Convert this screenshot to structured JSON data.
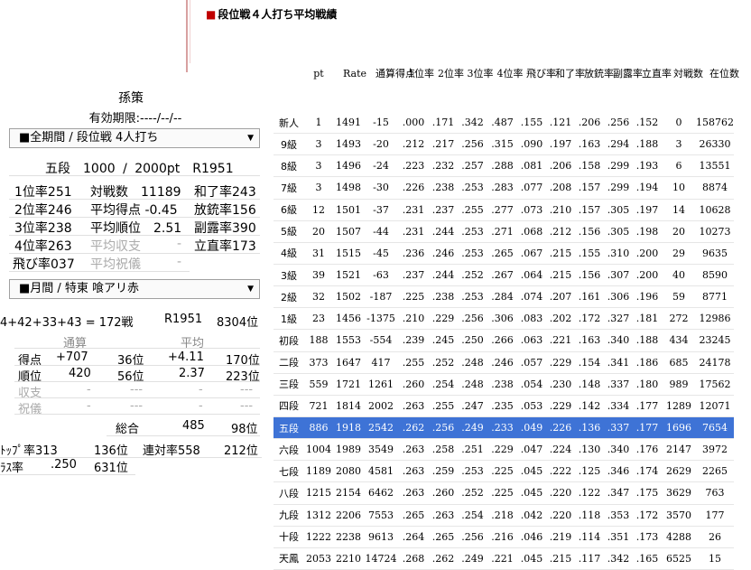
{
  "page_title": "段位戦４人打ち平均戦績",
  "player": {
    "name": "孫策",
    "valid_until": "有効期限:----/--/--"
  },
  "section1": {
    "dropdown": "■全期間 / 段位戦 4人打ち",
    "rank_line": "五段　1000 / 2000pt　R1951",
    "stats": {
      "r1": {
        "a": "1位率251",
        "b": "対戦数　11189",
        "c": "和了率243"
      },
      "r2": {
        "a": "2位率246",
        "b": "平均得点 -0.45",
        "c": "放銃率156"
      },
      "r3": {
        "a": "3位率238",
        "b": "平均順位　2.51",
        "c": "副露率390"
      },
      "r4": {
        "a": "4位率263",
        "b": "平均収支",
        "b2": "-",
        "c": "立直率173"
      },
      "r5": {
        "a": "飛び率037",
        "b": "平均祝儀",
        "b2": "-"
      }
    }
  },
  "section2": {
    "dropdown": "■月間 / 特東 喰アリ赤",
    "line1": {
      "games": "4+42+33+43 = 172戦",
      "rating": "R1951",
      "rank": "8304位"
    },
    "head": {
      "total": "通算",
      "avg": "平均"
    },
    "rows": [
      {
        "label": "得点",
        "v1": "+707",
        "v2": "36位",
        "v3": "+4.11",
        "v4": "170位"
      },
      {
        "label": "順位",
        "v1": "420",
        "v2": "56位",
        "v3": "2.37",
        "v4": "223位"
      },
      {
        "label": "収支",
        "v1": "-",
        "v2": "---",
        "v3": "-",
        "v4": "---"
      },
      {
        "label": "祝儀",
        "v1": "-",
        "v2": "---",
        "v3": "-",
        "v4": "---"
      }
    ],
    "overall": {
      "label": "総合",
      "v1": "485",
      "v2": "98位"
    },
    "top": {
      "a": "ﾄｯﾌﾟ率313",
      "b": "136位",
      "c": "連対率558",
      "d": "212位"
    },
    "las": {
      "a": "ﾗｽ率",
      "b": ".250",
      "c": "631位"
    }
  },
  "table": {
    "headers": [
      "pt",
      "Rate",
      "通算得点",
      "1位率",
      "2位率",
      "3位率",
      "4位率",
      "飛び率",
      "和了率",
      "放銃率",
      "副露率",
      "立直率",
      "対戦数",
      "在位数"
    ],
    "rows": [
      [
        "新人",
        "1",
        "1491",
        "-15",
        ".000",
        ".171",
        ".342",
        ".487",
        ".155",
        ".121",
        ".206",
        ".256",
        ".152",
        "0",
        "158762"
      ],
      [
        "9級",
        "3",
        "1493",
        "-20",
        ".212",
        ".217",
        ".256",
        ".315",
        ".090",
        ".197",
        ".163",
        ".294",
        ".188",
        "3",
        "26330"
      ],
      [
        "8級",
        "3",
        "1496",
        "-24",
        ".223",
        ".232",
        ".257",
        ".288",
        ".081",
        ".206",
        ".158",
        ".299",
        ".193",
        "6",
        "13551"
      ],
      [
        "7級",
        "3",
        "1498",
        "-30",
        ".226",
        ".238",
        ".253",
        ".283",
        ".077",
        ".208",
        ".157",
        ".299",
        ".194",
        "10",
        "8874"
      ],
      [
        "6級",
        "12",
        "1501",
        "-37",
        ".231",
        ".237",
        ".255",
        ".277",
        ".073",
        ".210",
        ".157",
        ".305",
        ".197",
        "14",
        "10628"
      ],
      [
        "5級",
        "20",
        "1507",
        "-44",
        ".231",
        ".244",
        ".253",
        ".271",
        ".068",
        ".212",
        ".156",
        ".305",
        ".198",
        "20",
        "10273"
      ],
      [
        "4級",
        "31",
        "1515",
        "-45",
        ".236",
        ".246",
        ".253",
        ".265",
        ".067",
        ".215",
        ".155",
        ".310",
        ".200",
        "29",
        "9635"
      ],
      [
        "3級",
        "39",
        "1521",
        "-63",
        ".237",
        ".244",
        ".252",
        ".267",
        ".064",
        ".215",
        ".156",
        ".307",
        ".200",
        "40",
        "8590"
      ],
      [
        "2級",
        "32",
        "1502",
        "-187",
        ".225",
        ".238",
        ".253",
        ".284",
        ".074",
        ".207",
        ".161",
        ".306",
        ".196",
        "59",
        "8771"
      ],
      [
        "1級",
        "23",
        "1456",
        "-1375",
        ".210",
        ".229",
        ".256",
        ".306",
        ".083",
        ".202",
        ".172",
        ".327",
        ".181",
        "272",
        "12986"
      ],
      [
        "初段",
        "188",
        "1553",
        "-554",
        ".239",
        ".245",
        ".250",
        ".266",
        ".063",
        ".221",
        ".163",
        ".340",
        ".188",
        "434",
        "23245"
      ],
      [
        "二段",
        "373",
        "1647",
        "417",
        ".255",
        ".252",
        ".248",
        ".246",
        ".057",
        ".229",
        ".154",
        ".341",
        ".186",
        "685",
        "24178"
      ],
      [
        "三段",
        "559",
        "1721",
        "1261",
        ".260",
        ".254",
        ".248",
        ".238",
        ".054",
        ".230",
        ".148",
        ".337",
        ".180",
        "989",
        "17562"
      ],
      [
        "四段",
        "721",
        "1814",
        "2002",
        ".263",
        ".255",
        ".247",
        ".235",
        ".053",
        ".229",
        ".142",
        ".334",
        ".177",
        "1289",
        "12071"
      ],
      [
        "五段",
        "886",
        "1918",
        "2542",
        ".262",
        ".256",
        ".249",
        ".233",
        ".049",
        ".226",
        ".136",
        ".337",
        ".177",
        "1696",
        "7654"
      ],
      [
        "六段",
        "1004",
        "1989",
        "3549",
        ".263",
        ".258",
        ".251",
        ".229",
        ".047",
        ".224",
        ".130",
        ".340",
        ".176",
        "2147",
        "3972"
      ],
      [
        "七段",
        "1189",
        "2080",
        "4581",
        ".263",
        ".259",
        ".253",
        ".225",
        ".045",
        ".222",
        ".125",
        ".346",
        ".174",
        "2629",
        "2265"
      ],
      [
        "八段",
        "1215",
        "2154",
        "6462",
        ".263",
        ".260",
        ".252",
        ".225",
        ".045",
        ".220",
        ".122",
        ".347",
        ".175",
        "3629",
        "763"
      ],
      [
        "九段",
        "1312",
        "2206",
        "7553",
        ".265",
        ".263",
        ".254",
        ".218",
        ".042",
        ".220",
        ".118",
        ".353",
        ".172",
        "3570",
        "177"
      ],
      [
        "十段",
        "1222",
        "2238",
        "9613",
        ".264",
        ".265",
        ".256",
        ".216",
        ".046",
        ".219",
        ".114",
        ".351",
        ".173",
        "4288",
        "26"
      ],
      [
        "天鳳",
        "2053",
        "2210",
        "14724",
        ".268",
        ".262",
        ".249",
        ".221",
        ".045",
        ".215",
        ".117",
        ".342",
        ".165",
        "6525",
        "15"
      ]
    ],
    "highlight_index": 14
  }
}
